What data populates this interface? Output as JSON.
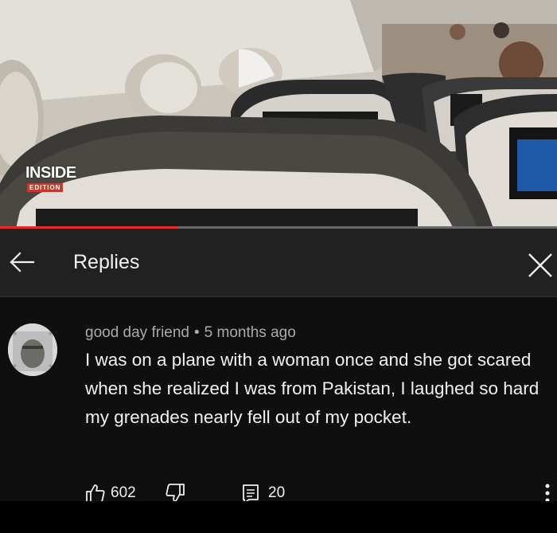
{
  "video": {
    "watermark_main": "INSIDE",
    "watermark_sub": "EDITION",
    "progress_fraction": 0.32,
    "accent_color": "#e52d27"
  },
  "header": {
    "back_icon": "arrow-left-icon",
    "title": "Replies",
    "close_icon": "close-icon"
  },
  "comment": {
    "author": "good day friend",
    "separator": "•",
    "time": "5 months ago",
    "text": "I was on a plane with a woman once and she got scared when she realized I was from Pakistan, I laughed so hard my grenades nearly fell out of my pocket.",
    "likes": "602",
    "replies": "20",
    "icons": {
      "like": "thumbs-up-icon",
      "dislike": "thumbs-down-icon",
      "reply": "reply-icon",
      "more": "more-vertical-icon"
    }
  }
}
